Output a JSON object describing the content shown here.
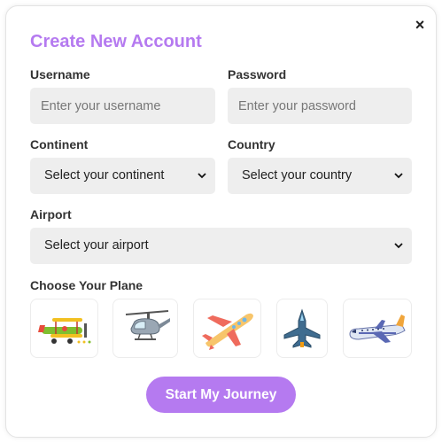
{
  "dialog": {
    "title": "Create New Account",
    "close_glyph": "×"
  },
  "form": {
    "username": {
      "label": "Username",
      "placeholder": "Enter your username",
      "value": ""
    },
    "password": {
      "label": "Password",
      "placeholder": "Enter your password",
      "value": ""
    },
    "continent": {
      "label": "Continent",
      "selected": "Select your continent"
    },
    "country": {
      "label": "Country",
      "selected": "Select your country"
    },
    "airport": {
      "label": "Airport",
      "selected": "Select your airport"
    }
  },
  "planes": {
    "label": "Choose Your Plane",
    "options": [
      {
        "icon": "biplane-icon"
      },
      {
        "icon": "helicopter-icon"
      },
      {
        "icon": "airplane-icon"
      },
      {
        "icon": "fighter-jet-icon"
      },
      {
        "icon": "airliner-icon"
      }
    ]
  },
  "submit_label": "Start My Journey",
  "colors": {
    "accent": "#b57af0",
    "field_bg": "#eeeeee"
  }
}
